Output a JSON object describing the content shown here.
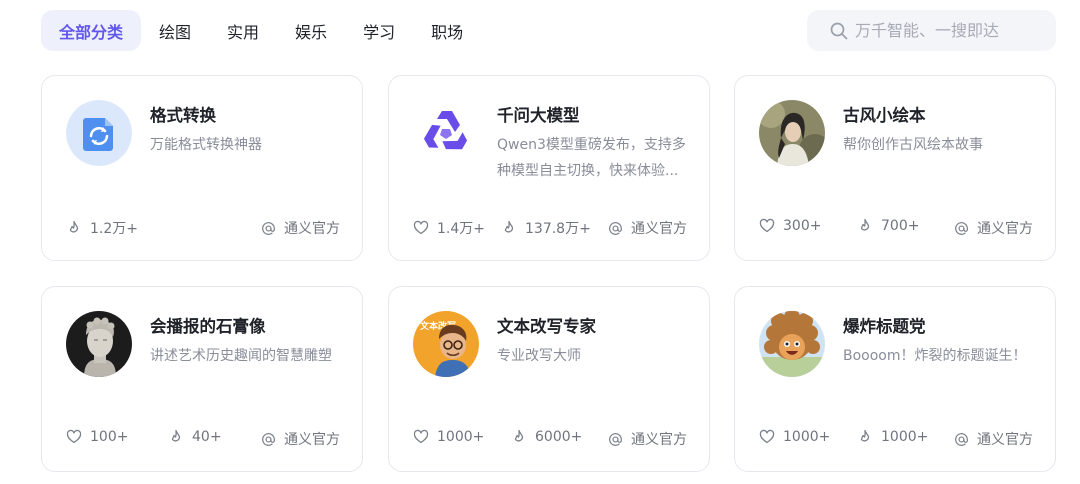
{
  "tabs": [
    {
      "label": "全部分类",
      "active": true
    },
    {
      "label": "绘图"
    },
    {
      "label": "实用"
    },
    {
      "label": "娱乐"
    },
    {
      "label": "学习"
    },
    {
      "label": "职场"
    }
  ],
  "search": {
    "placeholder": "万千智能、一搜即达",
    "icon": "search-icon"
  },
  "cards": [
    {
      "title": "格式转换",
      "desc": "万能格式转换神器",
      "avatar": "file-convert-icon",
      "likes": null,
      "uses": "1.2万+",
      "author": "通义官方"
    },
    {
      "title": "千问大模型",
      "desc": "Qwen3模型重磅发布，支持多种模型自主切换，快来体验...",
      "avatar": "qwen-logo",
      "likes": "1.4万+",
      "uses": "137.8万+",
      "author": "通义官方"
    },
    {
      "title": "古风小绘本",
      "desc": "帮你创作古风绘本故事",
      "avatar": "ancient-style-portrait",
      "likes": "300+",
      "uses": "700+",
      "author": "通义官方"
    },
    {
      "title": "会播报的石膏像",
      "desc": "讲述艺术历史趣闻的智慧雕塑",
      "avatar": "plaster-statue-portrait",
      "likes": "100+",
      "uses": "40+",
      "author": "通义官方"
    },
    {
      "title": "文本改写专家",
      "desc": "专业改写大师",
      "avatar": "cartoon-writer-portrait",
      "avatar_text": "文本改写",
      "likes": "1000+",
      "uses": "6000+",
      "author": "通义官方"
    },
    {
      "title": "爆炸标题党",
      "desc": "Boooom！炸裂的标题诞生！",
      "avatar": "explosion-hair-character",
      "likes": "1000+",
      "uses": "1000+",
      "author": "通义官方"
    }
  ],
  "colors": {
    "accent": "#6257ec",
    "tab_active_bg": "#eef0fc",
    "search_bg": "#f4f5f9",
    "border": "#e7e8ee",
    "muted": "#888d99"
  }
}
